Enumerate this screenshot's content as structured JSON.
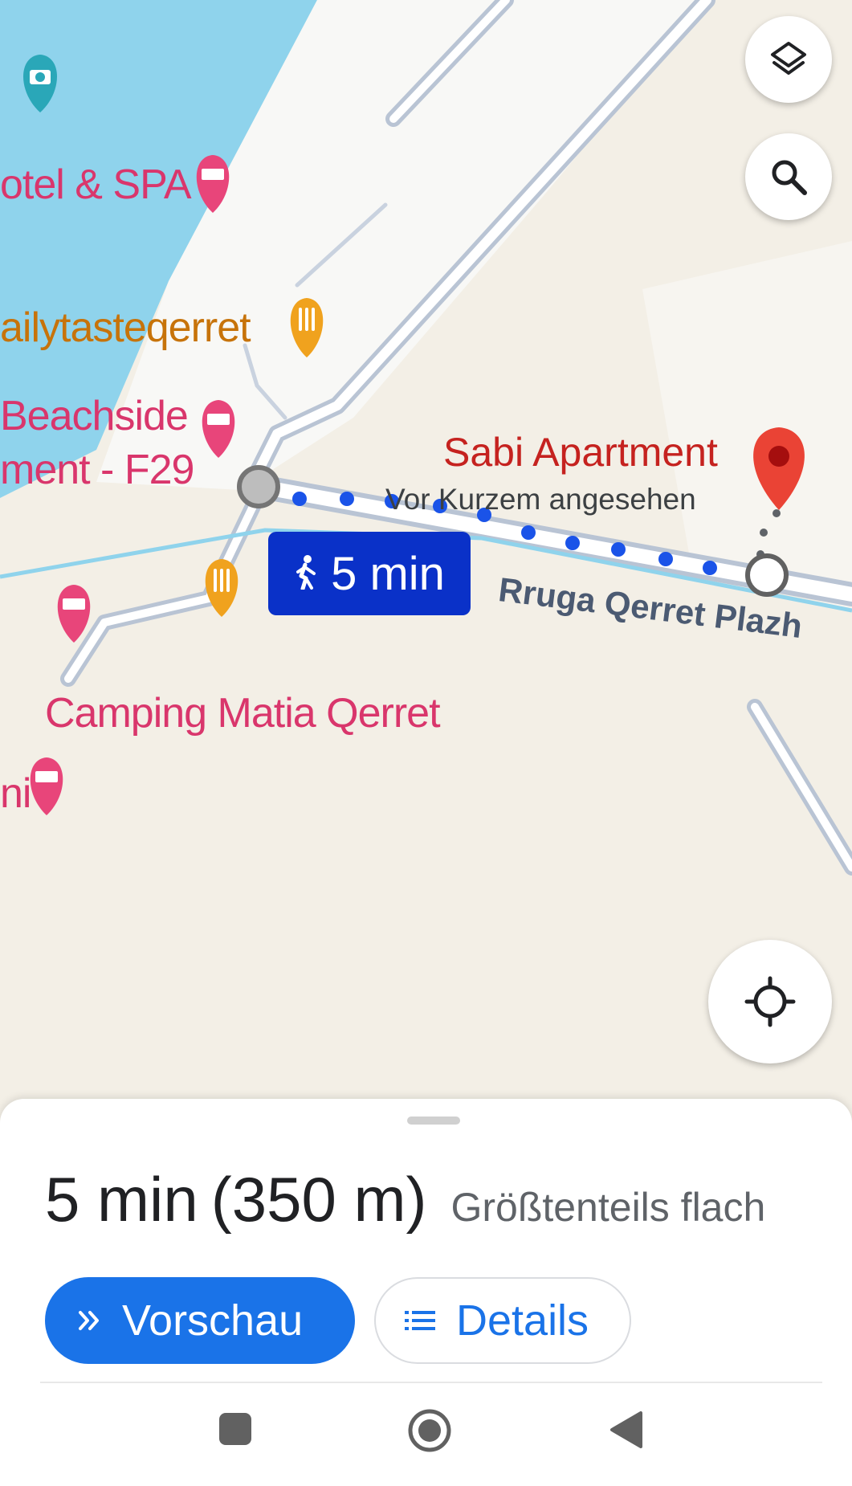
{
  "map": {
    "labels": {
      "hotel_spa": "otel & SPA",
      "restaurant_1": "ailytasteqerret",
      "beachside_line1": "Beachside",
      "beachside_line2": "ment - F29",
      "camping": "Camping Matia Qerret",
      "partial_hotel": "ni",
      "street": "Rruga Qerret Plazh"
    },
    "destination": {
      "name": "Sabi Apartment",
      "subtitle": "Vor Kurzem angesehen"
    },
    "route_badge": {
      "mode_icon": "walking-icon",
      "duration": "5 min"
    },
    "controls": {
      "layers": "layers-icon",
      "search": "search-icon",
      "my_location": "my-location-icon"
    },
    "colors": {
      "water": "#8fd3ec",
      "road": "#ffffff",
      "road_outline": "#b9c4d4",
      "route_dots": "#1a53e8",
      "lodging": "#e8457a",
      "food": "#f0a21e",
      "destination_pin": "#ea4335"
    }
  },
  "summary": {
    "duration": "5 min",
    "distance": "(350 m)",
    "terrain": "Größtenteils flach"
  },
  "actions": {
    "preview_label": "Vorschau",
    "preview_icon": "double-chevron-right-icon",
    "details_label": "Details",
    "details_icon": "list-icon"
  },
  "system_nav": {
    "recents": "square-icon",
    "home": "circle-icon",
    "back": "triangle-back-icon"
  }
}
